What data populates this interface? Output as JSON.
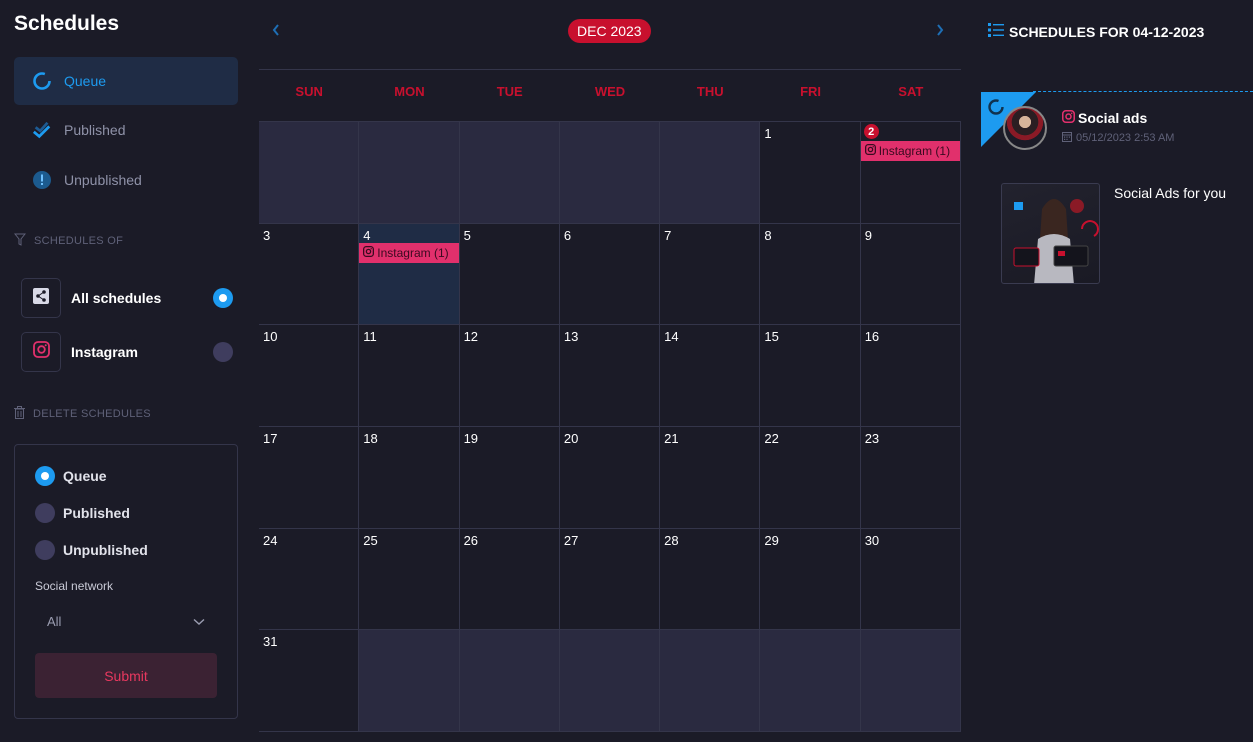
{
  "sidebar": {
    "title": "Schedules",
    "status_items": [
      {
        "label": "Queue",
        "icon": "spinner-icon",
        "active": true
      },
      {
        "label": "Published",
        "icon": "double-check-icon",
        "active": false
      },
      {
        "label": "Unpublished",
        "icon": "exclamation-circle-icon",
        "active": false
      }
    ],
    "schedules_of_label": "SCHEDULES OF",
    "networks": [
      {
        "label": "All schedules",
        "icon": "share-icon",
        "selected": true
      },
      {
        "label": "Instagram",
        "icon": "instagram-icon",
        "selected": false
      }
    ],
    "delete_label": "DELETE SCHEDULES",
    "delete_form": {
      "options": [
        {
          "label": "Queue",
          "selected": true
        },
        {
          "label": "Published",
          "selected": false
        },
        {
          "label": "Unpublished",
          "selected": false
        }
      ],
      "social_network_label": "Social network",
      "social_network_value": "All",
      "submit_label": "Submit"
    }
  },
  "calendar": {
    "month_label": "DEC 2023",
    "prev_label": "‹",
    "next_label": "›",
    "weekdays": [
      "SUN",
      "MON",
      "TUE",
      "WED",
      "THU",
      "FRI",
      "SAT"
    ],
    "cells": [
      {
        "day": "",
        "out": true
      },
      {
        "day": "",
        "out": true
      },
      {
        "day": "",
        "out": true
      },
      {
        "day": "",
        "out": true
      },
      {
        "day": "",
        "out": true
      },
      {
        "day": "1"
      },
      {
        "day": "2",
        "today": true,
        "event": "Instagram (1)"
      },
      {
        "day": "3"
      },
      {
        "day": "4",
        "selected": true,
        "event": "Instagram (1)"
      },
      {
        "day": "5"
      },
      {
        "day": "6"
      },
      {
        "day": "7"
      },
      {
        "day": "8"
      },
      {
        "day": "9"
      },
      {
        "day": "10"
      },
      {
        "day": "11"
      },
      {
        "day": "12"
      },
      {
        "day": "13"
      },
      {
        "day": "14"
      },
      {
        "day": "15"
      },
      {
        "day": "16"
      },
      {
        "day": "17"
      },
      {
        "day": "18"
      },
      {
        "day": "19"
      },
      {
        "day": "20"
      },
      {
        "day": "21"
      },
      {
        "day": "22"
      },
      {
        "day": "23"
      },
      {
        "day": "24"
      },
      {
        "day": "25"
      },
      {
        "day": "26"
      },
      {
        "day": "27"
      },
      {
        "day": "28"
      },
      {
        "day": "29"
      },
      {
        "day": "30"
      },
      {
        "day": "31"
      },
      {
        "day": "",
        "out": true
      },
      {
        "day": "",
        "out": true
      },
      {
        "day": "",
        "out": true
      },
      {
        "day": "",
        "out": true
      },
      {
        "day": "",
        "out": true
      },
      {
        "day": "",
        "out": true
      }
    ]
  },
  "right_panel": {
    "title": "SCHEDULES FOR 04-12-2023",
    "post": {
      "name": "Social ads",
      "network": "Instagram",
      "date": "05/12/2023 2:53 AM",
      "description": "Social Ads for you",
      "status": "queue"
    }
  },
  "colors": {
    "accent_blue": "#1d9bf0",
    "accent_red": "#c8102e",
    "instagram_pink": "#e1306c",
    "background": "#1b1b27"
  }
}
